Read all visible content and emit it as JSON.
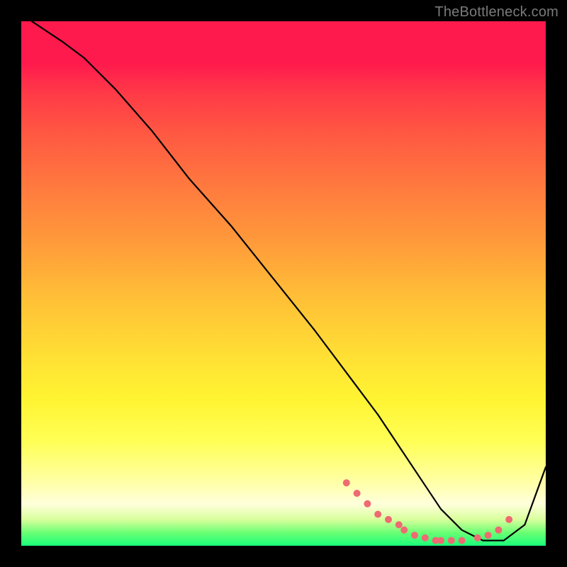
{
  "watermark": "TheBottleneck.com",
  "chart_data": {
    "type": "line",
    "title": "",
    "xlabel": "",
    "ylabel": "",
    "xlim": [
      0,
      100
    ],
    "ylim": [
      0,
      100
    ],
    "grid": false,
    "legend": "none",
    "series": [
      {
        "name": "bottleneck-curve",
        "color": "#000000",
        "x": [
          2,
          5,
          8,
          12,
          18,
          25,
          32,
          40,
          48,
          56,
          62,
          68,
          72,
          76,
          80,
          84,
          88,
          92,
          96,
          100
        ],
        "y": [
          100,
          98,
          96,
          93,
          87,
          79,
          70,
          61,
          51,
          41,
          33,
          25,
          19,
          13,
          7,
          3,
          1,
          1,
          4,
          15
        ]
      }
    ],
    "markers": [
      {
        "name": "highlighted-points",
        "color": "#ef6a72",
        "x": [
          62,
          64,
          66,
          68,
          70,
          72,
          73,
          75,
          77,
          79,
          80,
          82,
          84,
          87,
          89,
          91,
          93
        ],
        "y": [
          12,
          10,
          8,
          6,
          5,
          4,
          3,
          2,
          1.5,
          1,
          1,
          1,
          1,
          1.5,
          2,
          3,
          5
        ]
      }
    ]
  }
}
